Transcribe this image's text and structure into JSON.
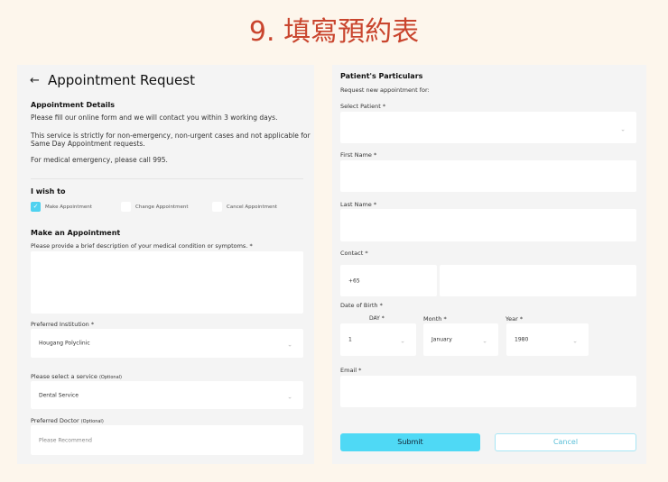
{
  "page_title": "9. 填寫預約表",
  "left": {
    "header": "Appointment Request",
    "details_heading": "Appointment Details",
    "p1": "Please fill our online form and we will contact you within 3 working days.",
    "p2a": "This service is strictly for non-emergency, non-urgent cases and not applicable for",
    "p2b": "Same Day Appointment requests.",
    "p3": "For medical emergency, please call 995.",
    "wish_heading": "I wish to",
    "options": [
      {
        "label": "Make Appointment",
        "checked": true
      },
      {
        "label": "Change Appointment",
        "checked": false
      },
      {
        "label": "Cancel Appointment",
        "checked": false
      }
    ],
    "make_heading": "Make an Appointment",
    "desc_label": "Please provide a brief description of your medical condition or symptoms. *",
    "desc_value": "",
    "institution_label": "Preferred Institution *",
    "institution_value": "Hougang Polyclinic",
    "service_label": "Please select a service",
    "optional": "(Optional)",
    "service_value": "Dental Service",
    "doctor_label": "Preferred Doctor",
    "doctor_placeholder": "Please Recommend"
  },
  "right": {
    "heading": "Patient's Particulars",
    "sub": "Request new appointment for:",
    "select_patient_label": "Select Patient *",
    "first_name_label": "First Name *",
    "last_name_label": "Last Name *",
    "contact_label": "Contact *",
    "country_code": "+65",
    "dob_label": "Date of Birth *",
    "day_label": "DAY *",
    "day_value": "1",
    "month_label": "Month *",
    "month_value": "January",
    "year_label": "Year *",
    "year_value": "1980",
    "email_label": "Email *",
    "submit": "Submit",
    "cancel": "Cancel"
  },
  "colors": {
    "accent": "#4fd9f5",
    "title": "#c9452e"
  }
}
